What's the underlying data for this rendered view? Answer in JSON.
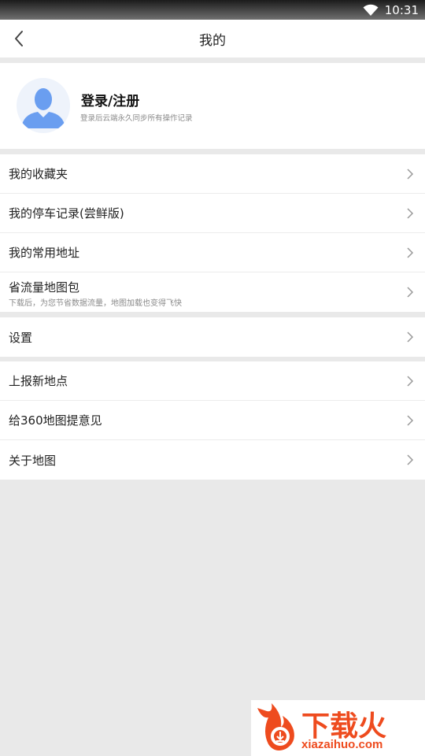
{
  "status_bar": {
    "time": "10:31"
  },
  "nav": {
    "title": "我的"
  },
  "profile": {
    "name": "登录/注册",
    "desc": "登录后云端永久同步所有操作记录"
  },
  "menu": {
    "favorites": "我的收藏夹",
    "parking": "我的停车记录(尝鲜版)",
    "addresses": "我的常用地址",
    "offline_map": {
      "label": "省流量地图包",
      "sub": "下载后，为您节省数据流量，地图加载也变得飞快"
    },
    "settings": "设置",
    "report_place": "上报新地点",
    "feedback": "给360地图提意见",
    "about": "关于地图"
  },
  "watermark": {
    "text": "下载火",
    "url": "xiazaihuo.com"
  },
  "colors": {
    "watermark": "#ee4b1e",
    "avatar": "#6a9ef0"
  }
}
